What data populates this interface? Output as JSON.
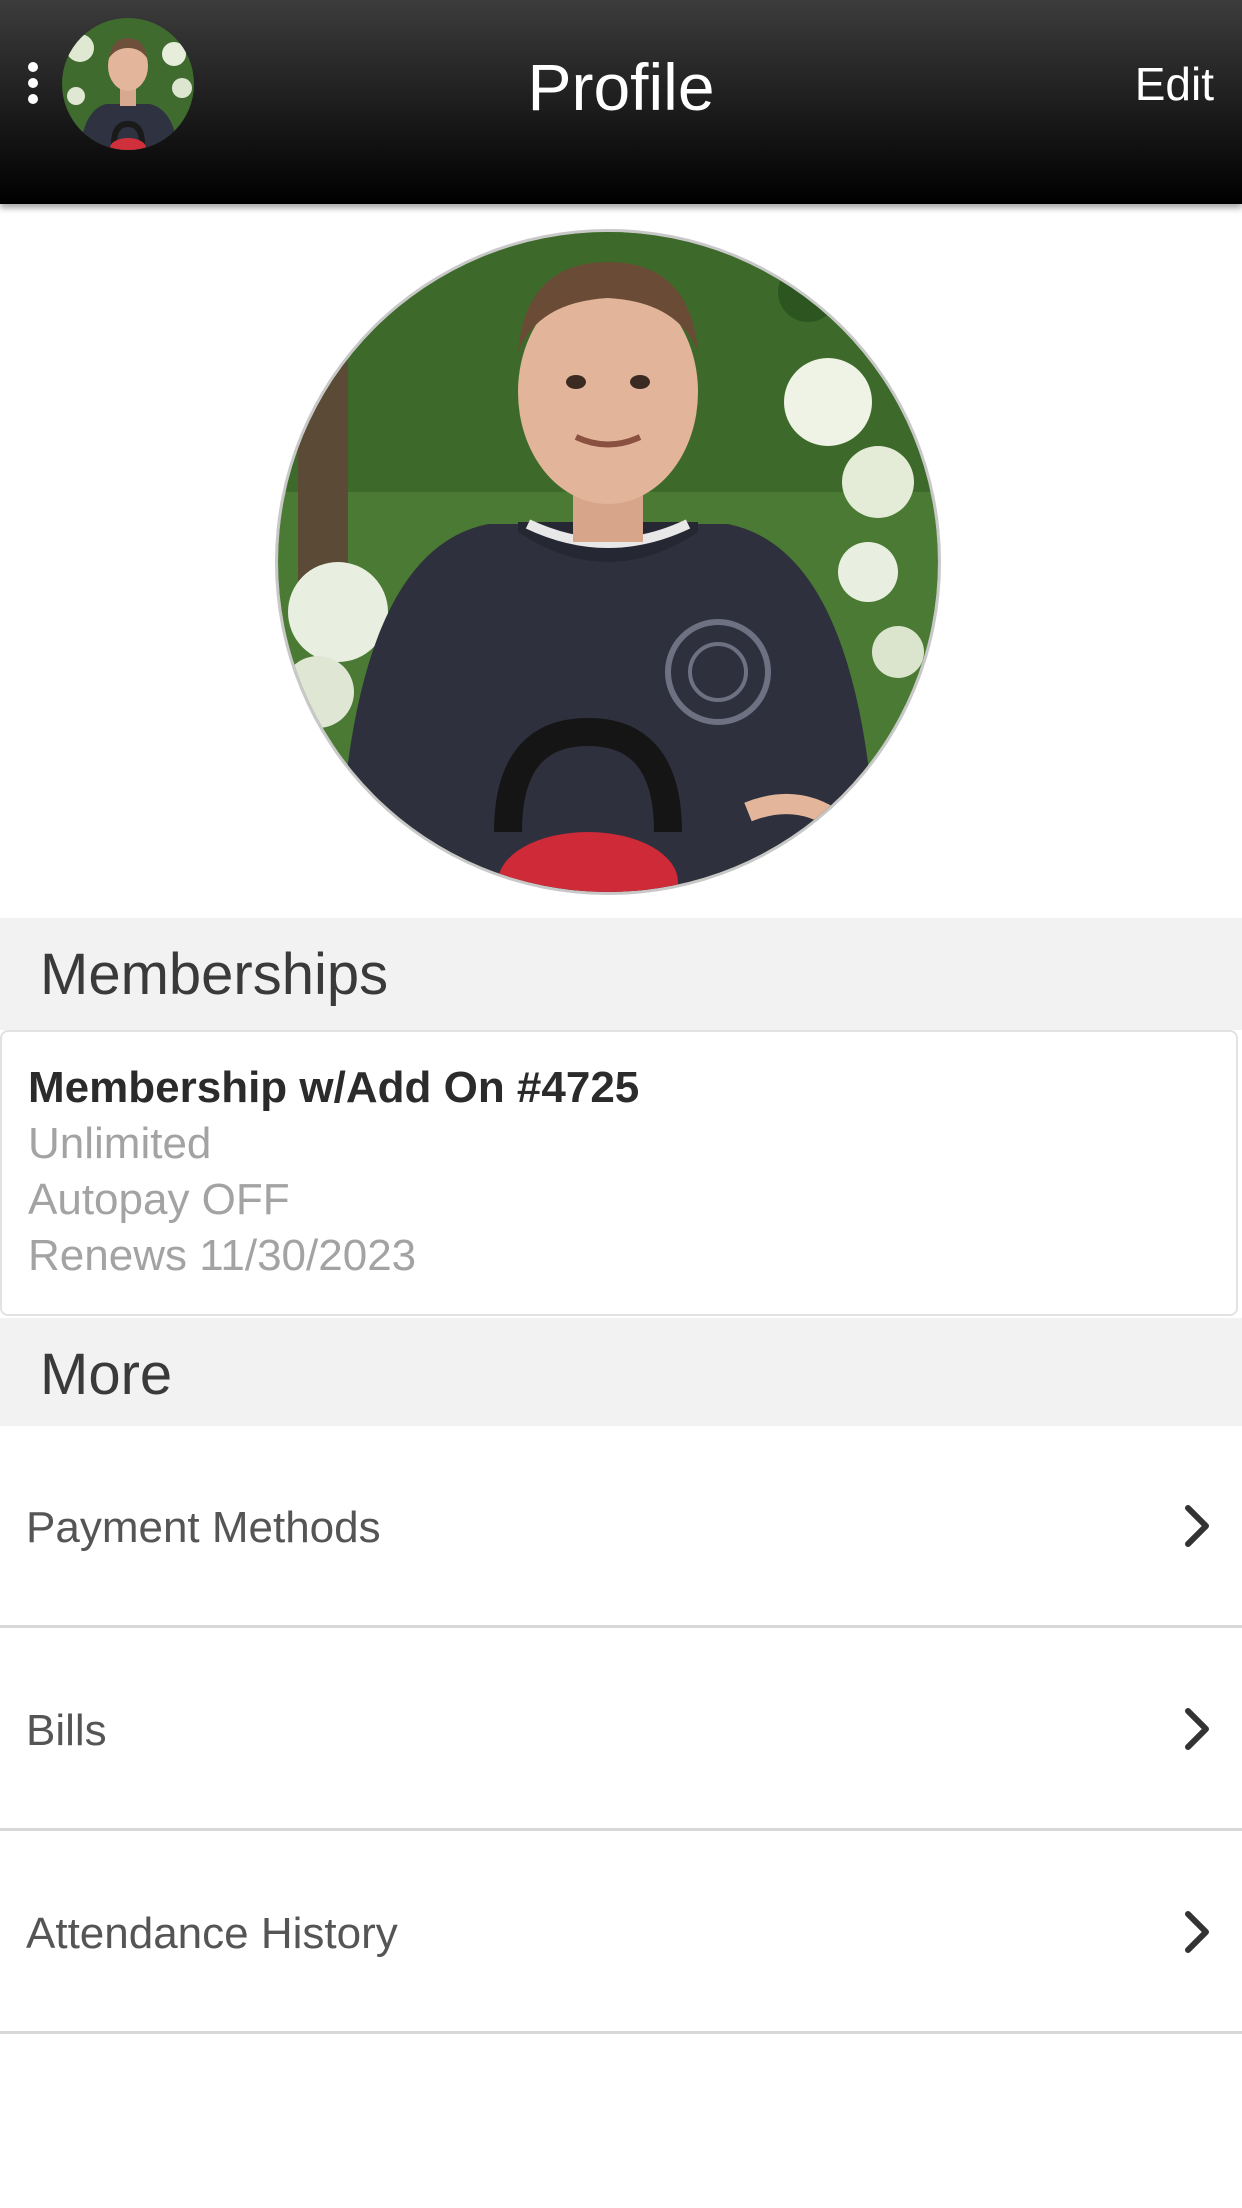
{
  "header": {
    "title": "Profile",
    "edit_label": "Edit",
    "menu_icon": "kebab-menu-icon",
    "avatar": "user-avatar"
  },
  "profile": {
    "photo": "profile-photo"
  },
  "memberships": {
    "section_title": "Memberships",
    "items": [
      {
        "name": "Membership w/Add On #4725",
        "plan": "Unlimited",
        "autopay": "Autopay OFF",
        "renews": "Renews 11/30/2023"
      }
    ]
  },
  "more": {
    "section_title": "More",
    "items": [
      {
        "label": "Payment Methods",
        "icon": "chevron-right-icon"
      },
      {
        "label": "Bills",
        "icon": "chevron-right-icon"
      },
      {
        "label": "Attendance History",
        "icon": "chevron-right-icon"
      }
    ]
  },
  "colors": {
    "header_top": "#3c3c3c",
    "header_bottom": "#000000",
    "section_bg": "#f2f2f2",
    "muted_text": "#a3a3a3",
    "body_text": "#555555"
  }
}
